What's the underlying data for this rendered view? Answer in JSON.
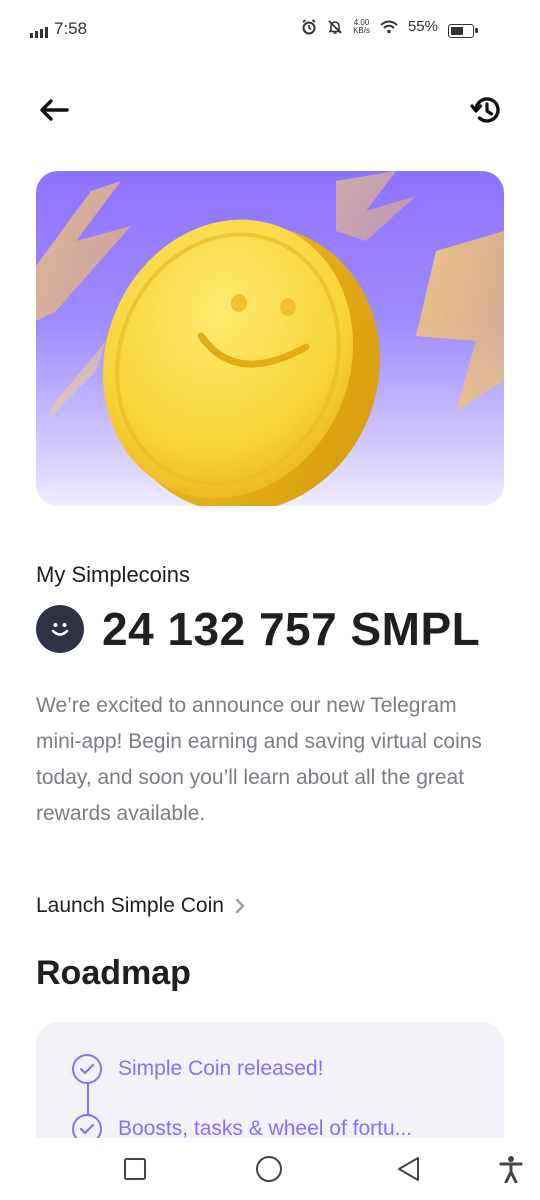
{
  "status_bar": {
    "time": "7:58",
    "network_speed_value": "4.00",
    "network_speed_unit": "KB/s",
    "battery_percent": "55%",
    "battery_level": 0.55,
    "icons": [
      "signal-icon",
      "alarm-icon",
      "silent-icon",
      "wifi-icon",
      "battery-icon"
    ]
  },
  "header": {
    "back_icon": "arrow-left-icon",
    "history_icon": "history-icon"
  },
  "hero": {
    "image": "smiling-gold-coin-illustration",
    "colors": {
      "purple": "#8f72ff",
      "coin_gold": "#ffd93d"
    }
  },
  "balance": {
    "label": "My Simplecoins",
    "value": "24 132 757 SMPL"
  },
  "description": "We’re excited to announce our new Telegram mini-app! Begin earning and saving virtual coins today, and soon you’ll learn about all the great rewards available.",
  "launch_link": {
    "label": "Launch Simple Coin"
  },
  "roadmap": {
    "title": "Roadmap",
    "items": [
      {
        "label": "Simple Coin released!",
        "status": "done"
      },
      {
        "label": "Boosts, tasks & wheel of fortu...",
        "status": "done"
      }
    ],
    "accent": "#8f6bff"
  },
  "nav_bar": {
    "buttons": [
      "recents-button",
      "home-button",
      "back-button",
      "accessibility-button"
    ]
  }
}
